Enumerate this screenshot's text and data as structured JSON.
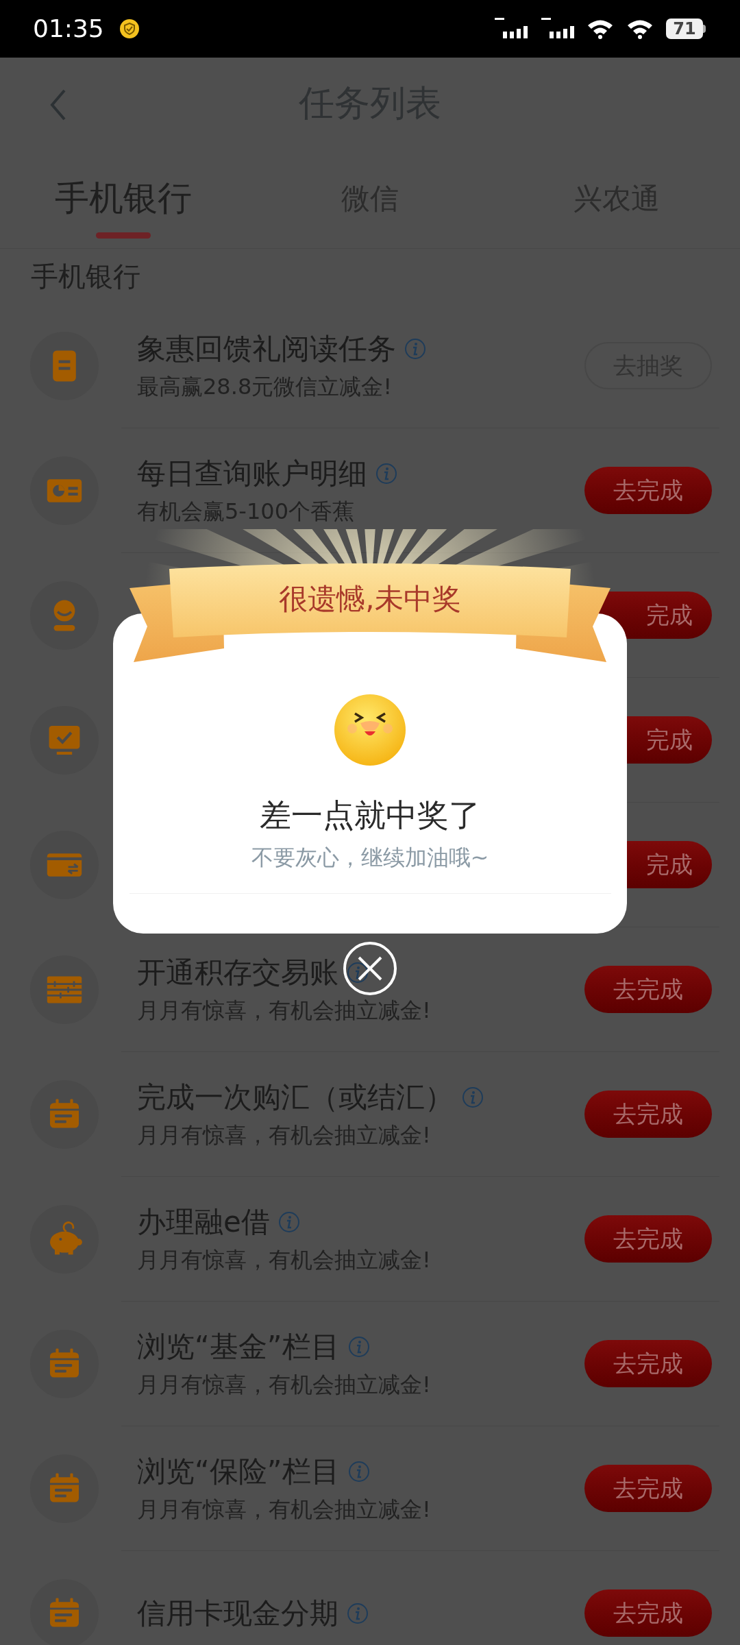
{
  "status_bar": {
    "time": "01:35",
    "battery": "71"
  },
  "header": {
    "title": "任务列表"
  },
  "tabs": [
    {
      "label": "手机银行",
      "selected": true
    },
    {
      "label": "微信",
      "selected": false
    },
    {
      "label": "兴农通",
      "selected": false
    }
  ],
  "section": {
    "title": "手机银行"
  },
  "tasks": [
    {
      "kind": "document",
      "title": "象惠回馈礼阅读任务",
      "subtitle": "最高赢28.8元微信立减金!",
      "button": {
        "label": "去抽奖",
        "kind": "outline"
      }
    },
    {
      "kind": "chart-card",
      "title": "每日查询账户明细",
      "subtitle": "有机会赢5-100个香蕉",
      "button": {
        "label": "去完成",
        "kind": "filled"
      }
    },
    {
      "kind": "person",
      "button": {
        "label": "完成",
        "kind": "covered"
      }
    },
    {
      "kind": "monitor",
      "button": {
        "label": "完成",
        "kind": "covered"
      }
    },
    {
      "kind": "card",
      "button": {
        "label": "完成",
        "kind": "covered"
      }
    },
    {
      "kind": "abacus",
      "title": "开通积存交易账",
      "subtitle": "月月有惊喜，有机会抽立减金!",
      "button": {
        "label": "去完成",
        "kind": "filled"
      }
    },
    {
      "kind": "calendar",
      "title": "完成一次购汇（或结汇）",
      "subtitle": "月月有惊喜，有机会抽立减金!",
      "button": {
        "label": "去完成",
        "kind": "filled"
      }
    },
    {
      "kind": "piggy",
      "title": "办理融e借",
      "subtitle": "月月有惊喜，有机会抽立减金!",
      "button": {
        "label": "去完成",
        "kind": "filled"
      }
    },
    {
      "kind": "calendar",
      "title": "浏览“基金”栏目",
      "subtitle": "月月有惊喜，有机会抽立减金!",
      "button": {
        "label": "去完成",
        "kind": "filled"
      }
    },
    {
      "kind": "calendar",
      "title": "浏览“保险”栏目",
      "subtitle": "月月有惊喜，有机会抽立减金!",
      "button": {
        "label": "去完成",
        "kind": "filled"
      }
    },
    {
      "kind": "calendar",
      "title": "信用卡现金分期",
      "button": {
        "label": "去完成",
        "kind": "filled"
      }
    }
  ],
  "dialog": {
    "banner": "很遗憾,未中奖",
    "title": "差一点就中奖了",
    "message": "不要灰心，继续加油哦~"
  }
}
